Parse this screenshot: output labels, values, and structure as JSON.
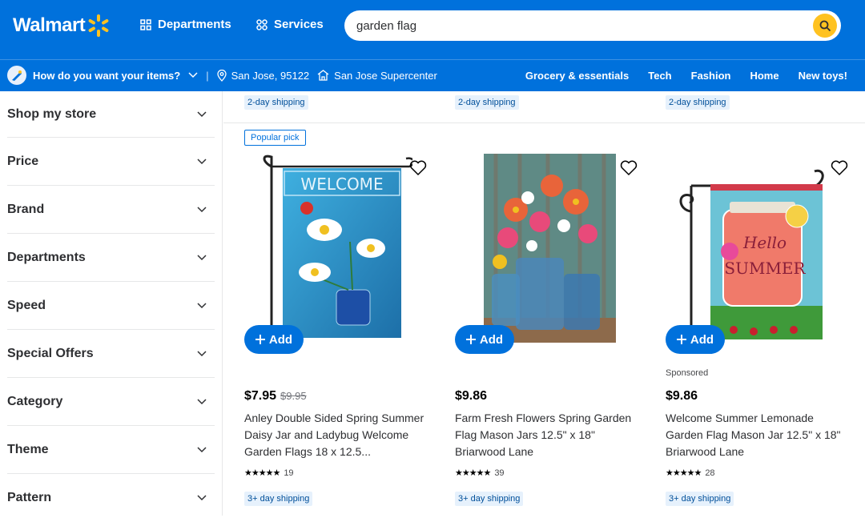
{
  "header": {
    "logo_text": "Walmart",
    "departments_label": "Departments",
    "services_label": "Services",
    "search_value": "garden flag"
  },
  "subbar": {
    "question": "How do you want your items?",
    "location": "San Jose, 95122",
    "store": "San Jose Supercenter",
    "links": [
      "Grocery & essentials",
      "Tech",
      "Fashion",
      "Home",
      "New toys!"
    ]
  },
  "sidebar": {
    "filters": [
      "Shop my store",
      "Price",
      "Brand",
      "Departments",
      "Speed",
      "Special Offers",
      "Category",
      "Theme",
      "Pattern"
    ]
  },
  "top_row": {
    "shipping": [
      "2-day shipping",
      "2-day shipping",
      "2-day shipping"
    ]
  },
  "products": [
    {
      "badge": "Popular pick",
      "add_label": "Add",
      "price": "$7.95",
      "was_price": "$9.95",
      "title": "Anley Double Sided Spring Summer Daisy Jar and Ladybug Welcome Garden Flags 18 x 12.5...",
      "stars": "★★★★★",
      "reviews": "19",
      "shipping": "3+ day shipping",
      "image_text": "WELCOME"
    },
    {
      "add_label": "Add",
      "price": "$9.86",
      "title": "Farm Fresh Flowers Spring Garden Flag Mason Jars 12.5\" x 18\" Briarwood Lane",
      "stars": "★★★★★",
      "reviews": "39",
      "shipping": "3+ day shipping"
    },
    {
      "add_label": "Add",
      "sponsored": "Sponsored",
      "price": "$9.86",
      "title": "Welcome Summer Lemonade Garden Flag Mason Jar 12.5\" x 18\" Briarwood Lane",
      "stars": "★★★★★",
      "reviews": "28",
      "shipping": "3+ day shipping",
      "image_text_1": "Hello",
      "image_text_2": "SUMMER"
    }
  ],
  "colors": {
    "brand_blue": "#0071dc",
    "spark_yellow": "#ffc220"
  }
}
